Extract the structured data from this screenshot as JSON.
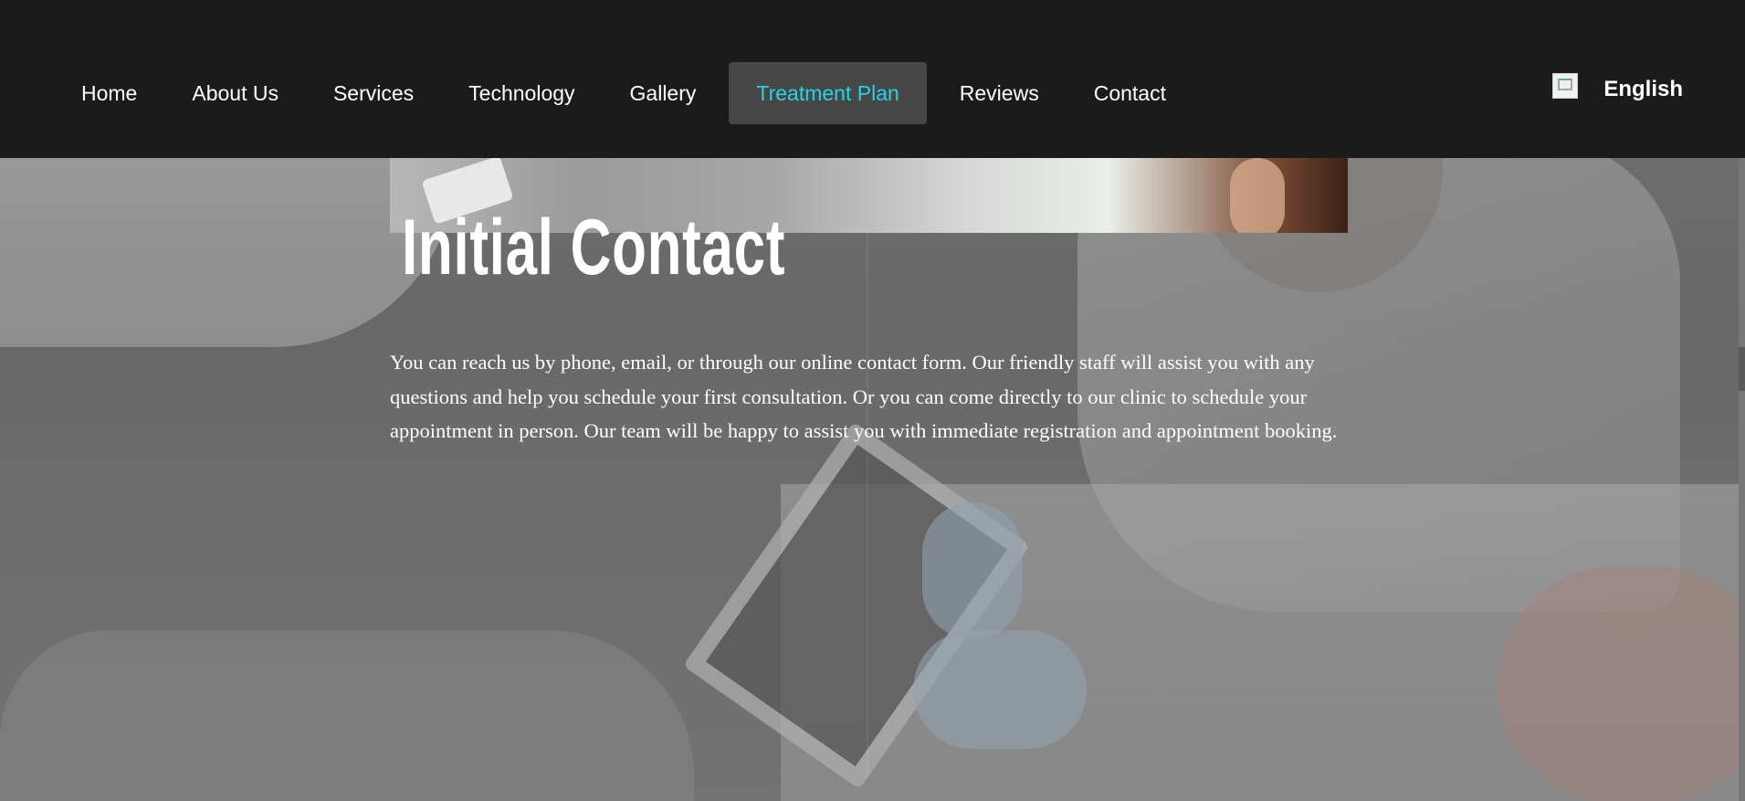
{
  "nav": {
    "items": [
      {
        "label": "Home"
      },
      {
        "label": "About Us"
      },
      {
        "label": "Services"
      },
      {
        "label": "Technology"
      },
      {
        "label": "Gallery"
      },
      {
        "label": "Treatment Plan",
        "active": true
      },
      {
        "label": "Reviews"
      },
      {
        "label": "Contact"
      }
    ],
    "language": {
      "label": "English",
      "icon": "flag-icon"
    }
  },
  "content": {
    "title": "Initial Contact",
    "description": "You can reach us by phone, email, or through our online contact form. Our friendly staff will assist you with any questions and help you schedule your first consultation. Or you can come directly to our clinic to schedule your appointment in person. Our team will be happy to assist you with immediate registration and appointment booking."
  },
  "colors": {
    "nav_background": "#1b1b1b",
    "active_item_background": "#474747",
    "active_item_text": "#27d3e6",
    "text": "#ffffff"
  }
}
